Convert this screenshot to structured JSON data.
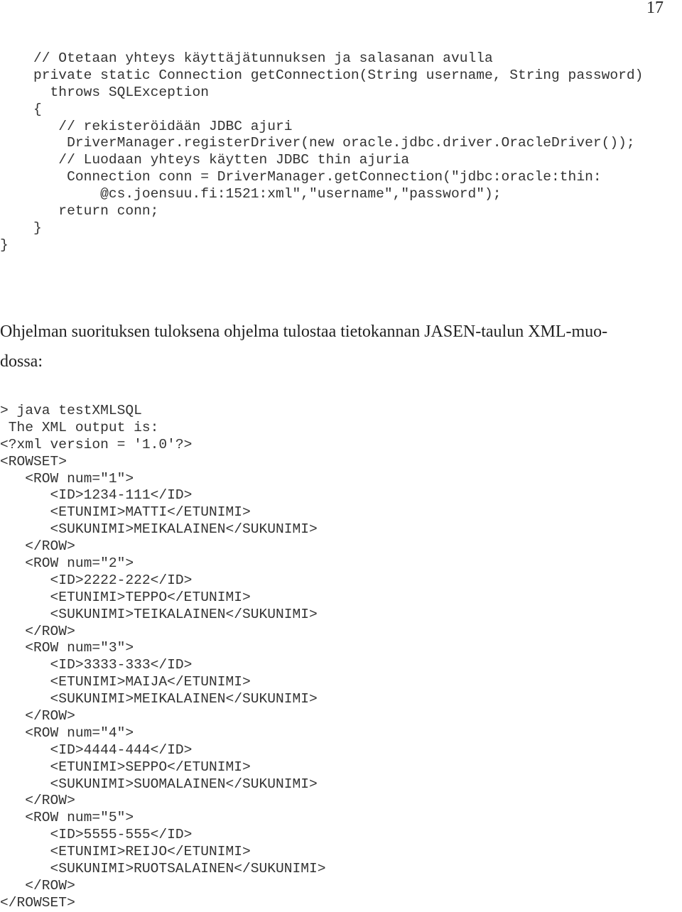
{
  "page_number": "17",
  "code_listing": [
    "    // Otetaan yhteys käyttäjätunnuksen ja salasanan avulla",
    "    private static Connection getConnection(String username, String password)",
    "      throws SQLException",
    "    {",
    "       // rekisteröidään JDBC ajuri",
    "        DriverManager.registerDriver(new oracle.jdbc.driver.OracleDriver());",
    "       // Luodaan yhteys käytten JDBC thin ajuria",
    "        Connection conn = DriverManager.getConnection(\"jdbc:oracle:thin:",
    "            @cs.joensuu.fi:1521:xml\",\"username\",\"password\");",
    "       return conn;",
    "    }",
    "}"
  ],
  "paragraph": "Ohjelman suorituksen tuloksena ohjelma tulostaa tietokannan JASEN-taulun XML-muodossa:",
  "paragraph_lines": [
    "Ohjelman suorituksen tuloksena ohjelma tulostaa tietokannan JASEN-taulun XML-muo-",
    "dossa:"
  ],
  "output_listing": [
    "> java testXMLSQL",
    " The XML output is:",
    "<?xml version = '1.0'?>",
    "<ROWSET>",
    "   <ROW num=\"1\">",
    "      <ID>1234-111</ID>",
    "      <ETUNIMI>MATTI</ETUNIMI>",
    "      <SUKUNIMI>MEIKALAINEN</SUKUNIMI>",
    "   </ROW>",
    "   <ROW num=\"2\">",
    "      <ID>2222-222</ID>",
    "      <ETUNIMI>TEPPO</ETUNIMI>",
    "      <SUKUNIMI>TEIKALAINEN</SUKUNIMI>",
    "   </ROW>",
    "   <ROW num=\"3\">",
    "      <ID>3333-333</ID>",
    "      <ETUNIMI>MAIJA</ETUNIMI>",
    "      <SUKUNIMI>MEIKALAINEN</SUKUNIMI>",
    "   </ROW>",
    "   <ROW num=\"4\">",
    "      <ID>4444-444</ID>",
    "      <ETUNIMI>SEPPO</ETUNIMI>",
    "      <SUKUNIMI>SUOMALAINEN</SUKUNIMI>",
    "   </ROW>",
    "   <ROW num=\"5\">",
    "      <ID>5555-555</ID>",
    "      <ETUNIMI>REIJO</ETUNIMI>",
    "      <SUKUNIMI>RUOTSALAINEN</SUKUNIMI>",
    "   </ROW>",
    "</ROWSET>"
  ]
}
